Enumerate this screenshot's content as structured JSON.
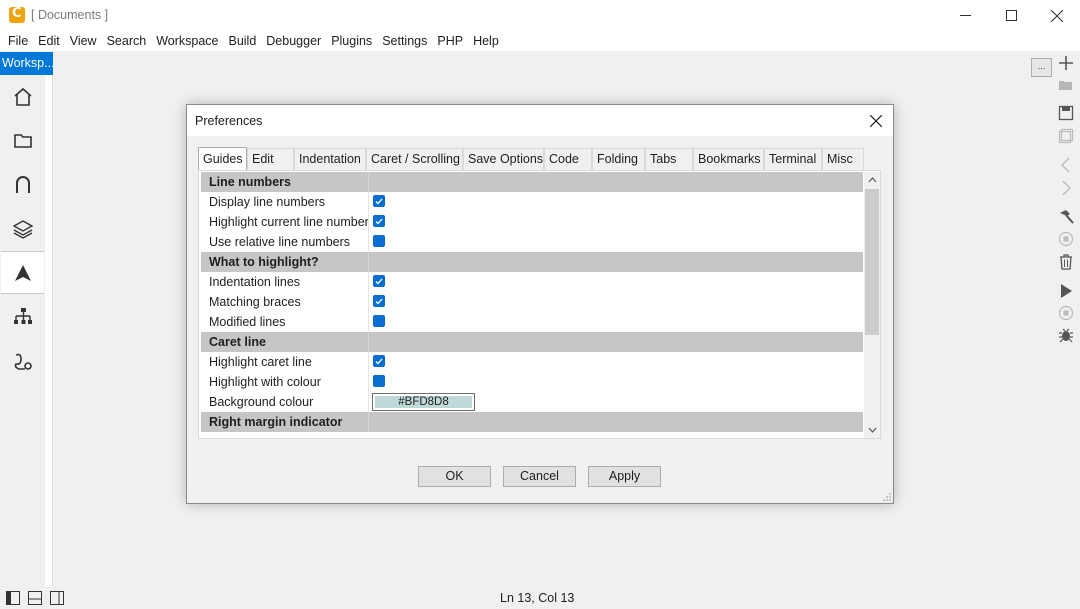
{
  "window": {
    "title": "[ Documents ]",
    "controls": {
      "minimize": "—",
      "maximize": "☐",
      "close": "✕"
    }
  },
  "menu": [
    "File",
    "Edit",
    "View",
    "Search",
    "Workspace",
    "Build",
    "Debugger",
    "Plugins",
    "Settings",
    "PHP",
    "Help"
  ],
  "left_dock": {
    "workspace_tab": "Worksp...",
    "icons": [
      "home-icon",
      "folder-icon",
      "magnet-icon",
      "layers-icon",
      "warning-triangle-icon",
      "hierarchy-icon",
      "plugin-icon"
    ]
  },
  "right_toolbar": {
    "ellipsis": "...",
    "icons": [
      "plus-icon",
      "open-folder-icon",
      "save-icon",
      "save-copy-icon",
      "back-arrow-icon",
      "forward-arrow-icon",
      "hammer-icon",
      "stop-circle-icon",
      "trash-icon",
      "play-icon",
      "stop-icon",
      "bug-icon"
    ]
  },
  "statusbar": {
    "position": "Ln 13, Col 13",
    "icons": [
      "left-panel-icon",
      "bottom-panel-icon",
      "right-panel-icon"
    ]
  },
  "dialog": {
    "title": "Preferences",
    "close": "✕",
    "tabs": [
      "Guides",
      "Edit",
      "Indentation",
      "Caret / Scrolling",
      "Save Options",
      "Code",
      "Folding",
      "Tabs",
      "Bookmarks",
      "Terminal",
      "Misc"
    ],
    "active_tab": "Guides",
    "rows": [
      {
        "type": "section",
        "label": "Line numbers"
      },
      {
        "type": "check",
        "label": "Display line numbers",
        "checked": true
      },
      {
        "type": "check",
        "label": "Highlight current line number",
        "checked": true
      },
      {
        "type": "check",
        "label": "Use relative line numbers",
        "checked": false
      },
      {
        "type": "section",
        "label": "What to highlight?"
      },
      {
        "type": "check",
        "label": "Indentation lines",
        "checked": true
      },
      {
        "type": "check",
        "label": "Matching braces",
        "checked": true
      },
      {
        "type": "check",
        "label": "Modified lines",
        "checked": false
      },
      {
        "type": "section",
        "label": "Caret line"
      },
      {
        "type": "check",
        "label": "Highlight caret line",
        "checked": true
      },
      {
        "type": "check",
        "label": "Highlight with colour",
        "checked": false
      },
      {
        "type": "color",
        "label": "Background colour",
        "value": "#BFD8D8"
      },
      {
        "type": "section",
        "label": "Right margin indicator"
      }
    ],
    "buttons": {
      "ok": "OK",
      "cancel": "Cancel",
      "apply": "Apply"
    }
  },
  "colors": {
    "accent": "#0078d7",
    "checkbox": "#0a6ed1",
    "section_bg": "#c6c6c6",
    "swatch": "#bfd8d8"
  }
}
